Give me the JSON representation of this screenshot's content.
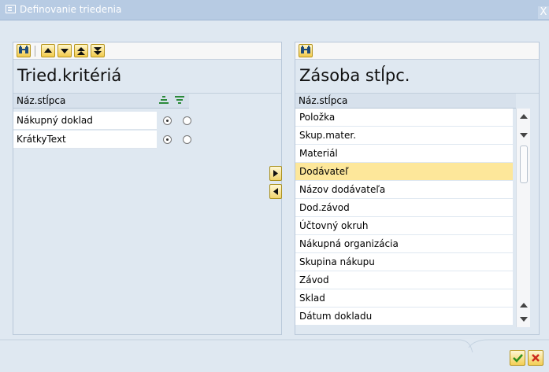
{
  "window": {
    "title": "Definovanie triedenia",
    "close_label": "X"
  },
  "left_panel": {
    "title": "Tried.kritériá",
    "column_header": "Náz.stĺpca",
    "rows": [
      {
        "label": "Nákupný doklad",
        "ascending": true
      },
      {
        "label": "KrátkyText",
        "ascending": true
      }
    ]
  },
  "right_panel": {
    "title": "Zásoba stĺpc.",
    "column_header": "Náz.stĺpca",
    "items": [
      {
        "label": "Položka",
        "selected": false
      },
      {
        "label": "Skup.mater.",
        "selected": false
      },
      {
        "label": "Materiál",
        "selected": false
      },
      {
        "label": "Dodávateľ",
        "selected": true
      },
      {
        "label": "Názov dodávateľa",
        "selected": false
      },
      {
        "label": "Dod.závod",
        "selected": false
      },
      {
        "label": "Účtovný okruh",
        "selected": false
      },
      {
        "label": "Nákupná organizácia",
        "selected": false
      },
      {
        "label": "Skupina nákupu",
        "selected": false
      },
      {
        "label": "Závod",
        "selected": false
      },
      {
        "label": "Sklad",
        "selected": false
      },
      {
        "label": "Dátum dokladu",
        "selected": false
      }
    ]
  },
  "icons": {
    "find": "binoculars-icon",
    "up": "up-triangle-icon",
    "down": "down-triangle-icon",
    "top": "move-top-icon",
    "bottom": "move-bottom-icon",
    "move_right": "arrow-right-icon",
    "move_left": "arrow-left-icon",
    "ok": "checkmark-icon",
    "cancel": "cross-icon"
  },
  "colors": {
    "titlebar": "#b7cbe3",
    "panel": "#dfe8f1",
    "selection": "#fde79a",
    "button": "#f3ce55",
    "ok_green": "#2f8f1d",
    "cancel_red": "#cc2b1d"
  }
}
